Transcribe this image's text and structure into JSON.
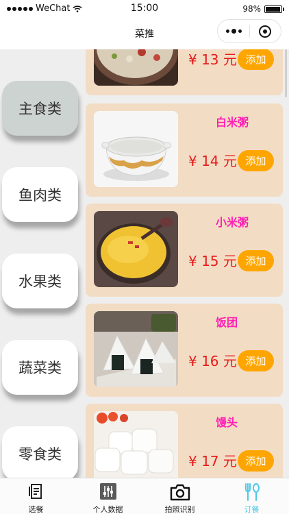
{
  "status_bar": {
    "carrier": "WeChat",
    "time": "15:00",
    "battery": "98%",
    "battery_level": 0.98
  },
  "nav": {
    "title": "菜推"
  },
  "categories": [
    {
      "label": "主食类",
      "active": true
    },
    {
      "label": "鱼肉类",
      "active": false
    },
    {
      "label": "水果类",
      "active": false
    },
    {
      "label": "蔬菜类",
      "active": false
    },
    {
      "label": "零食类",
      "active": false
    }
  ],
  "items": [
    {
      "name": "",
      "price": "¥ 13 元",
      "add_label": "添加",
      "image": "congee-meat"
    },
    {
      "name": "白米粥",
      "price": "¥ 14 元",
      "add_label": "添加",
      "image": "rice-porridge"
    },
    {
      "name": "小米粥",
      "price": "¥ 15 元",
      "add_label": "添加",
      "image": "millet-porridge"
    },
    {
      "name": "饭团",
      "price": "¥ 16 元",
      "add_label": "添加",
      "image": "rice-ball"
    },
    {
      "name": "馒头",
      "price": "¥ 17 元",
      "add_label": "添加",
      "image": "steamed-bun"
    }
  ],
  "tabs": [
    {
      "label": "选餐",
      "icon": "menu-list-icon",
      "active": false
    },
    {
      "label": "个人数据",
      "icon": "sliders-icon",
      "active": false
    },
    {
      "label": "拍照识别",
      "icon": "camera-icon",
      "active": false
    },
    {
      "label": "订餐",
      "icon": "fork-spoon-icon",
      "active": true
    }
  ],
  "colors": {
    "accent": "#ffa500",
    "price": "#e61b1b",
    "name": "#ff1fb4",
    "card": "#f3dcc4",
    "active_tab": "#4ec8e8"
  }
}
